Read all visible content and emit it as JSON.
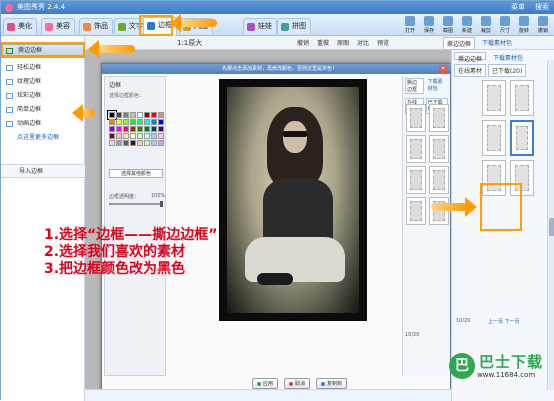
{
  "app": {
    "title": "美图秀秀 2.4.4",
    "title_right": [
      "菜单",
      "搜索"
    ]
  },
  "tabs": [
    {
      "label": "美化",
      "color": "#e64a8a"
    },
    {
      "label": "美容",
      "color": "#ff6a9a"
    },
    {
      "label": "饰品",
      "color": "#f08a3a"
    },
    {
      "label": "文字",
      "color": "#6aaa2a",
      "badge": "T"
    },
    {
      "label": "边框",
      "color": "#2a7ad0"
    },
    {
      "label": "闪图",
      "color": "#d0a02a"
    },
    {
      "label": "娃娃",
      "color": "#b04ad0"
    },
    {
      "label": "拼图",
      "color": "#3aa0a0"
    }
  ],
  "right_tools": [
    "打开",
    "保存",
    "截图",
    "新建",
    "裁剪",
    "尺寸",
    "旋转",
    "撤销"
  ],
  "subbar": {
    "zoom": "1:1原大",
    "actions": [
      "撤销",
      "重做",
      "原图",
      "对比",
      "预览"
    ],
    "panel_tabs": [
      "撕边边框",
      "下载素材包"
    ]
  },
  "sidebar": {
    "items": [
      {
        "label": "撕边边框",
        "active": true
      },
      {
        "label": "轻松边框"
      },
      {
        "label": "纹理边框"
      },
      {
        "label": "炫彩边框"
      },
      {
        "label": "简单边框"
      },
      {
        "label": "动画边框"
      }
    ],
    "link": "点这里更多边框",
    "import": "导入边框"
  },
  "dialog": {
    "title": "边框",
    "banner": "先要点击添加素材，再修改颜色，否则这里是灰色！",
    "left_title": "撕边边框",
    "color_label": "选择边框颜色：",
    "more_colors": "选择其他颜色",
    "opacity_label": "边框透明度：",
    "opacity_value": "100%",
    "opacity_level": 1.0,
    "right_tabs": [
      "撕边边框",
      "下载素材包"
    ],
    "right_subtabs": [
      "在线素材",
      "已下载(20)"
    ],
    "pager": "10/20",
    "buttons": [
      "应用",
      "取消",
      "复制到"
    ],
    "swatches": [
      "#000000",
      "#404040",
      "#808080",
      "#c0c0c0",
      "#ffffff",
      "#7f0000",
      "#ff0000",
      "#ff8080",
      "#ff8000",
      "#ffff00",
      "#80ff00",
      "#00ff00",
      "#00ff80",
      "#00ffff",
      "#0080ff",
      "#0000ff",
      "#8000ff",
      "#ff00ff",
      "#ff0080",
      "#804000",
      "#408000",
      "#008040",
      "#004080",
      "#400080",
      "#800040",
      "#ffc0c0",
      "#ffe0c0",
      "#ffffc0",
      "#c0ffc0",
      "#c0ffff",
      "#c0c0ff",
      "#ffc0ff",
      "#e0e0e0",
      "#a0a0a0",
      "#606060",
      "#202020",
      "#ffd0a0",
      "#d0ffa0",
      "#a0d0ff",
      "#d0a0ff"
    ]
  },
  "right_panel": {
    "tabs": [
      "撕边边框",
      "下载素材包"
    ],
    "sub": [
      "在线素材",
      "已下载(20)"
    ],
    "pager": "10/20",
    "pager_right": "上一页 下一页"
  },
  "instructions": [
    "1.选择“边框——撕边边框”",
    "2.选择我们喜欢的素材",
    "3.把边框颜色改为黑色"
  ],
  "watermark": {
    "name": "巴士下载",
    "url": "www.11684.com",
    "logo": "巴"
  },
  "colors": {
    "accent": "#ffa000",
    "instruction": "#e2001a",
    "titlebar": "#3e7cc5"
  }
}
